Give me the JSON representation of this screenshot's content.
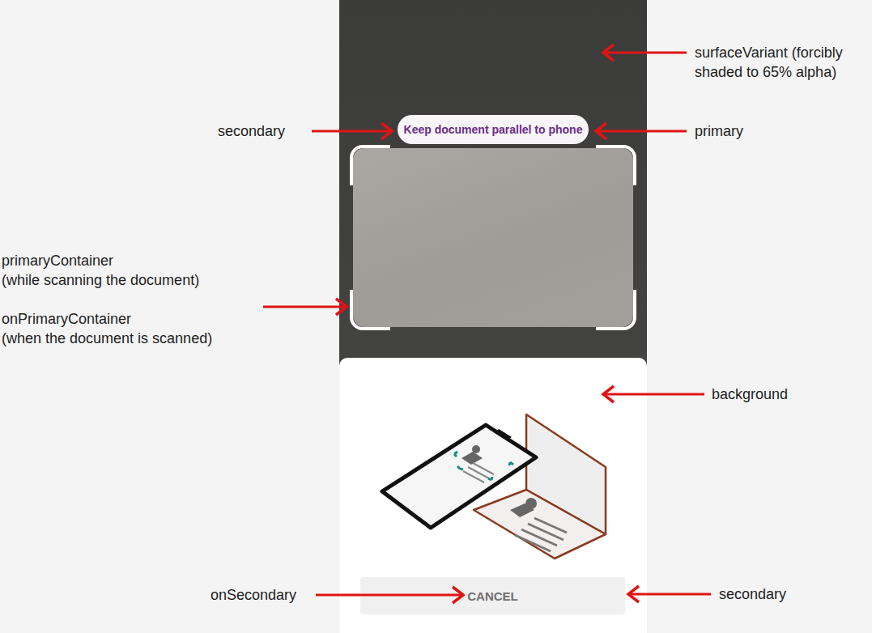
{
  "phone": {
    "hint": {
      "text": "Keep document parallel to phone"
    },
    "cancel_button": {
      "label": "CANCEL"
    }
  },
  "annotations": [
    {
      "blocks": [
        [
          "surfaceVariant (forcibly",
          "shaded to 65% alpha)"
        ]
      ]
    },
    {
      "blocks": [
        [
          "secondary"
        ]
      ]
    },
    {
      "blocks": [
        [
          "primary"
        ]
      ]
    },
    {
      "blocks": [
        [
          "primaryContainer",
          "(while scanning the document)"
        ],
        [
          "onPrimaryContainer",
          "(when the document is scanned)"
        ]
      ]
    },
    {
      "blocks": [
        [
          "background"
        ]
      ]
    },
    {
      "blocks": [
        [
          "onSecondary"
        ]
      ]
    },
    {
      "blocks": [
        [
          "secondary"
        ]
      ]
    }
  ]
}
